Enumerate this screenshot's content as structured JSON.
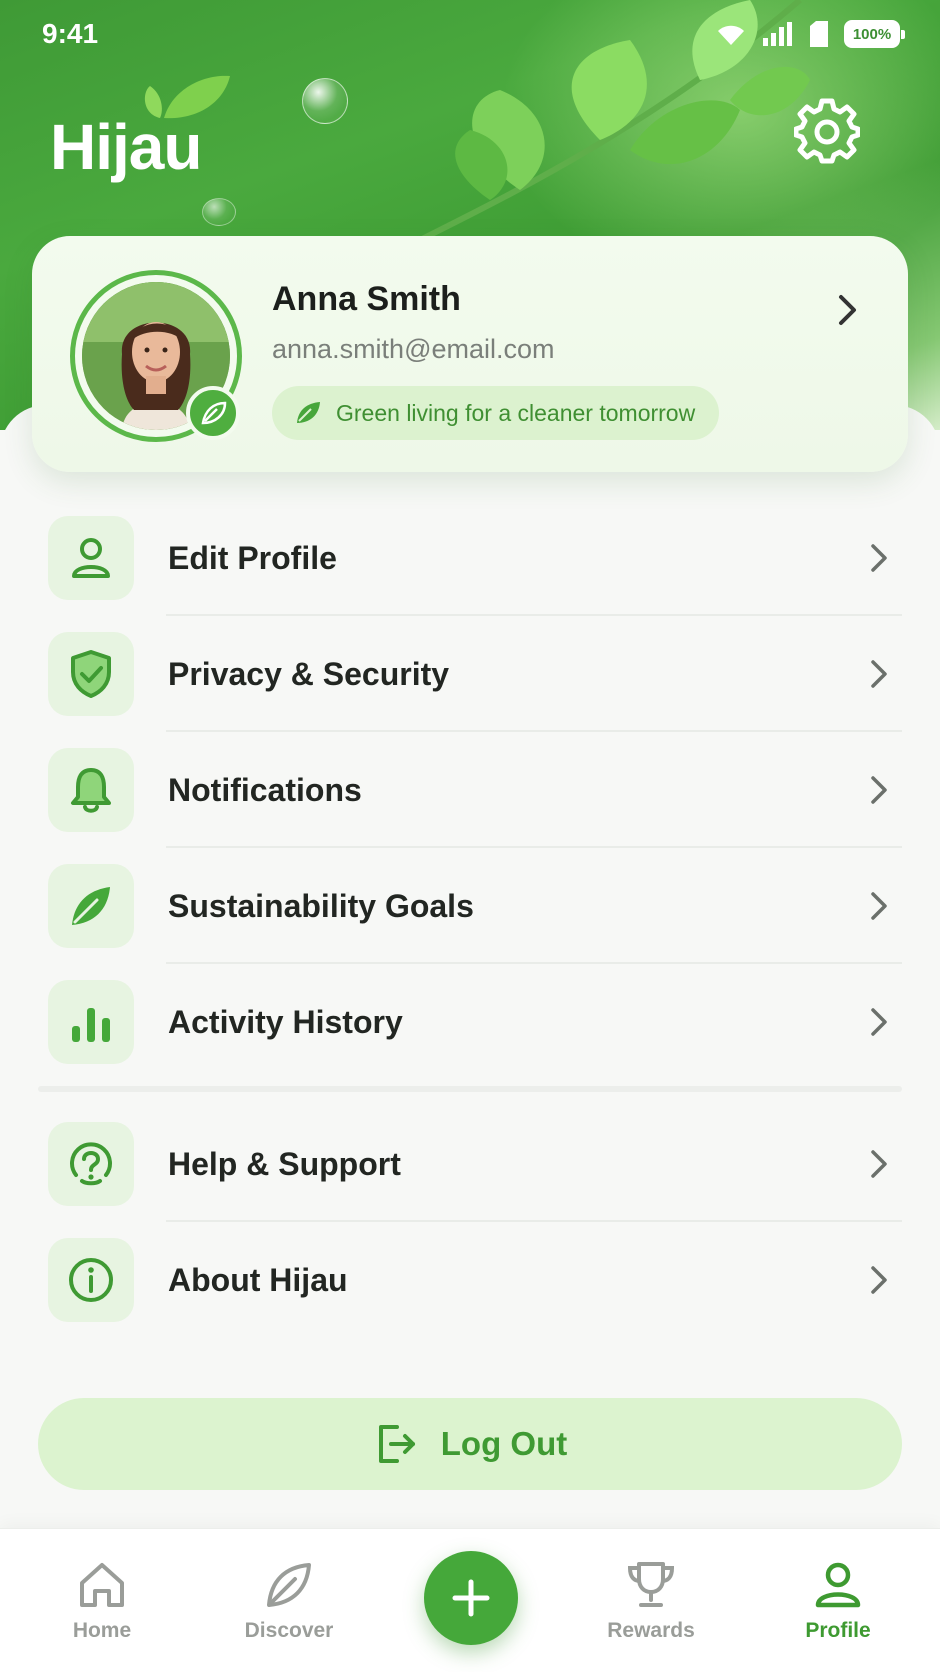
{
  "status_bar": {
    "time": "9:41",
    "battery": "100%"
  },
  "brand": {
    "name": "Hijau"
  },
  "profile": {
    "name": "Anna Smith",
    "email": "anna.smith@email.com",
    "tagline": "Green living for a cleaner tomorrow"
  },
  "menu": {
    "items": [
      {
        "label": "Edit Profile",
        "icon": "user-icon"
      },
      {
        "label": "Privacy & Security",
        "icon": "shield-check-icon"
      },
      {
        "label": "Notifications",
        "icon": "bell-icon"
      },
      {
        "label": "Sustainability Goals",
        "icon": "leaf-icon"
      },
      {
        "label": "Activity History",
        "icon": "bar-chart-icon"
      }
    ],
    "secondary_items": [
      {
        "label": "Help & Support",
        "icon": "help-circle-icon"
      },
      {
        "label": "About Hijau",
        "icon": "info-circle-icon"
      }
    ]
  },
  "logout": {
    "label": "Log Out"
  },
  "bottom_nav": {
    "items": [
      {
        "label": "Home",
        "icon": "home-icon",
        "active": false
      },
      {
        "label": "Discover",
        "icon": "leaf-outline-icon",
        "active": false
      },
      {
        "label": "Rewards",
        "icon": "trophy-icon",
        "active": false
      },
      {
        "label": "Profile",
        "icon": "person-icon",
        "active": true
      }
    ],
    "fab_icon": "plus-icon"
  },
  "colors": {
    "primary": "#45a83a",
    "primary_dark": "#3e9a31",
    "tile_bg": "#e7f4e1",
    "pill_bg": "#dcf3cf",
    "background": "#f7f8f6"
  }
}
